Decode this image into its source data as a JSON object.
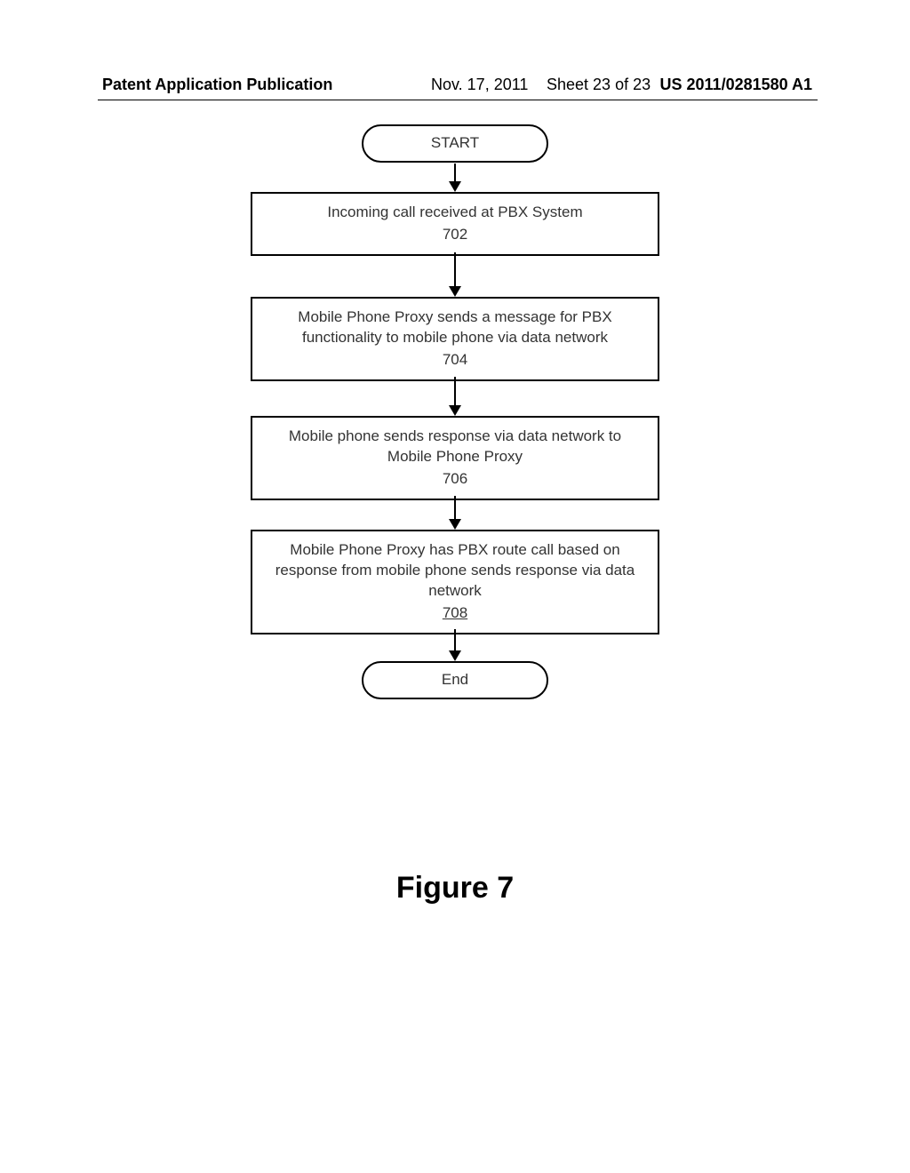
{
  "header": {
    "left": "Patent Application Publication",
    "date": "Nov. 17, 2011",
    "sheet": "Sheet 23 of 23",
    "pubno": "US 2011/0281580 A1"
  },
  "flow": {
    "start": "START",
    "end": "End",
    "steps": [
      {
        "text": "Incoming call received at PBX System",
        "ref": "702",
        "underline": false
      },
      {
        "text": "Mobile Phone Proxy sends a message for PBX functionality to mobile phone via data network",
        "ref": "704",
        "underline": false
      },
      {
        "text": "Mobile phone sends response via data network to Mobile Phone Proxy",
        "ref": "706",
        "underline": false
      },
      {
        "text": "Mobile Phone Proxy has PBX route call based on response from mobile phone sends response via data network",
        "ref": "708",
        "underline": true
      }
    ]
  },
  "figure_caption": "Figure 7"
}
